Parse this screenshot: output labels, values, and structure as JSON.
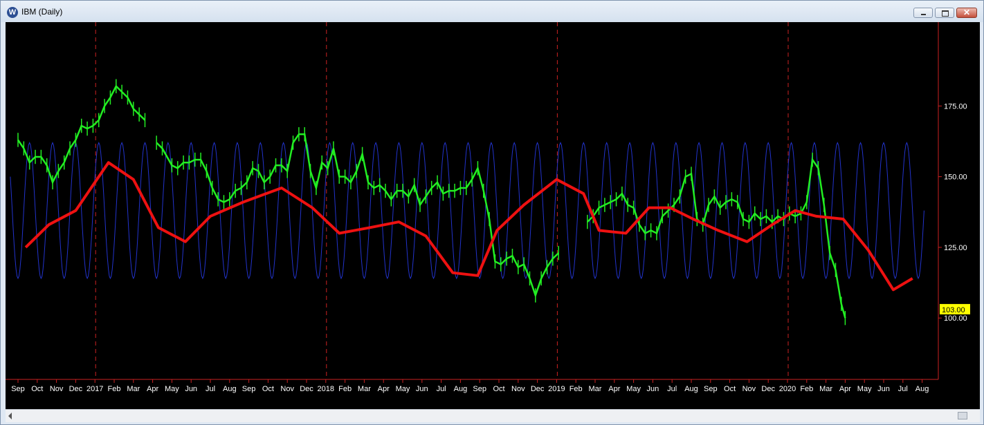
{
  "window": {
    "title": "IBM (Daily)",
    "app_icon": "W",
    "buttons": {
      "minimize": "minimize-icon",
      "maximize": "maximize-icon",
      "close": "close-icon"
    }
  },
  "chart_data": {
    "type": "line",
    "title": "",
    "ylim": [
      80,
      190
    ],
    "y_ticks": [
      "175.00",
      "150.00",
      "125.00",
      "100.00"
    ],
    "y_tick_values": [
      175,
      150,
      125,
      100
    ],
    "last_price": "103.00",
    "last_price_value": 103,
    "x_months": [
      "Sep",
      "Oct",
      "Nov",
      "Dec",
      "2017",
      "Feb",
      "Mar",
      "Apr",
      "May",
      "Jun",
      "Jul",
      "Aug",
      "Sep",
      "Oct",
      "Nov",
      "Dec",
      "2018",
      "Feb",
      "Mar",
      "Apr",
      "May",
      "Jun",
      "Jul",
      "Aug",
      "Sep",
      "Oct",
      "Nov",
      "Dec",
      "2019",
      "Feb",
      "Mar",
      "Apr",
      "May",
      "Jun",
      "Jul",
      "Aug",
      "Sep",
      "Oct",
      "Nov",
      "Dec",
      "2020",
      "Feb",
      "Mar",
      "Apr",
      "May",
      "Jun",
      "Jul",
      "Aug"
    ],
    "year_markers": [
      4,
      16,
      28,
      40
    ],
    "colors": {
      "price": "#22ee22",
      "cycle": "#2233cc",
      "projection": "#ee1111",
      "axis": "#cc2222",
      "label": "#ffff00"
    },
    "series": [
      {
        "type": "ohlc",
        "x": [
          0,
          0.3,
          0.6,
          0.9,
          1.2,
          1.5,
          1.8,
          2.1,
          2.4,
          2.7,
          3.0,
          3.3,
          3.6,
          3.9,
          4.2,
          4.5,
          4.8,
          5.1,
          5.4,
          5.7,
          6.0,
          6.3,
          6.6,
          6.9,
          7.2,
          7.5,
          8.0,
          8.3,
          8.6,
          8.9,
          9.2,
          9.5,
          9.8,
          10.1,
          10.4,
          10.7,
          11.0,
          11.3,
          11.6,
          11.9,
          12.2,
          12.5,
          12.8,
          13.1,
          13.4,
          13.7,
          14.0,
          14.3,
          14.6,
          14.9,
          15.2,
          15.5,
          15.8,
          16.1,
          16.4,
          16.7,
          17.0,
          17.3,
          17.6,
          17.9,
          18.2,
          18.5,
          18.8,
          19.1,
          19.4,
          19.7,
          20.0,
          20.3,
          20.6,
          20.9,
          21.2,
          21.5,
          21.8,
          22.1,
          22.4,
          22.7,
          23.0,
          23.3,
          23.6,
          23.9,
          24.2,
          24.5,
          24.8,
          25.1,
          25.4,
          25.7,
          26.0,
          26.3,
          26.6,
          26.9,
          27.2,
          27.5,
          27.8,
          28.1,
          28.4,
          28.7,
          29.0,
          29.3,
          29.6,
          29.9,
          30.2,
          30.5,
          30.8,
          31.1,
          31.4,
          31.7,
          32.0,
          32.3,
          32.6,
          32.9,
          33.2,
          33.5,
          33.8,
          34.1,
          34.4,
          34.7,
          35.0,
          35.3,
          35.6,
          35.9,
          36.2,
          36.5,
          36.8,
          37.1,
          37.4,
          37.7,
          38.0,
          38.3,
          38.6,
          38.9,
          39.2,
          39.5,
          39.8,
          40.1,
          40.4,
          40.7,
          41.0,
          41.3,
          41.6,
          41.9,
          42.2,
          42.5,
          42.8,
          43.0
        ],
        "y": [
          163,
          160,
          155,
          157,
          157,
          154,
          148,
          152,
          155,
          160,
          163,
          168,
          167,
          168,
          170,
          175,
          178,
          182,
          180,
          178,
          174,
          172,
          170,
          null,
          162,
          160,
          154,
          153,
          155,
          155,
          156,
          156,
          152,
          146,
          142,
          141,
          142,
          145,
          146,
          148,
          153,
          152,
          148,
          150,
          154,
          154,
          152,
          162,
          165,
          165,
          152,
          146,
          155,
          153,
          160,
          150,
          150,
          148,
          152,
          158,
          148,
          146,
          147,
          145,
          142,
          145,
          145,
          143,
          147,
          140,
          143,
          146,
          148,
          144,
          145,
          145,
          146,
          146,
          149,
          153,
          145,
          135,
          120,
          119,
          121,
          122,
          118,
          119,
          114,
          108,
          114,
          118,
          121,
          123,
          null,
          null,
          null,
          null,
          134,
          136,
          139,
          140,
          141,
          142,
          144,
          140,
          139,
          133,
          130,
          131,
          130,
          136,
          138,
          140,
          143,
          150,
          151,
          135,
          133,
          140,
          143,
          139,
          141,
          142,
          141,
          135,
          134,
          137,
          135,
          136,
          134,
          136,
          135,
          137,
          136,
          137,
          141,
          156,
          153,
          140,
          123,
          117,
          105,
          100
        ]
      },
      {
        "name": "",
        "type": "cycle",
        "amplitude": 24,
        "center": 138,
        "phase": 3.0,
        "period": 1.2
      },
      {
        "type": "projection",
        "x": [
          0.4,
          1.6,
          3.0,
          4.7,
          6.0,
          7.3,
          8.7,
          10.0,
          11.7,
          13.7,
          15.3,
          16.7,
          18.3,
          19.8,
          21.2,
          22.6,
          23.9,
          24.9,
          26.3,
          28.0,
          29.4,
          30.2,
          31.6,
          32.8,
          33.9,
          35.1,
          36.4,
          37.9,
          39.2,
          40.4,
          41.5,
          42.9,
          44.2,
          45.5,
          46.5
        ]
      }
    ],
    "projection_y": [
      125,
      133,
      138,
      155,
      149,
      132,
      127,
      136,
      141,
      146,
      139,
      130,
      132,
      134,
      129,
      116,
      115,
      131,
      140,
      149,
      144,
      131,
      130,
      139,
      139,
      135,
      131,
      127,
      133,
      138,
      136,
      135,
      124,
      110,
      114
    ]
  }
}
